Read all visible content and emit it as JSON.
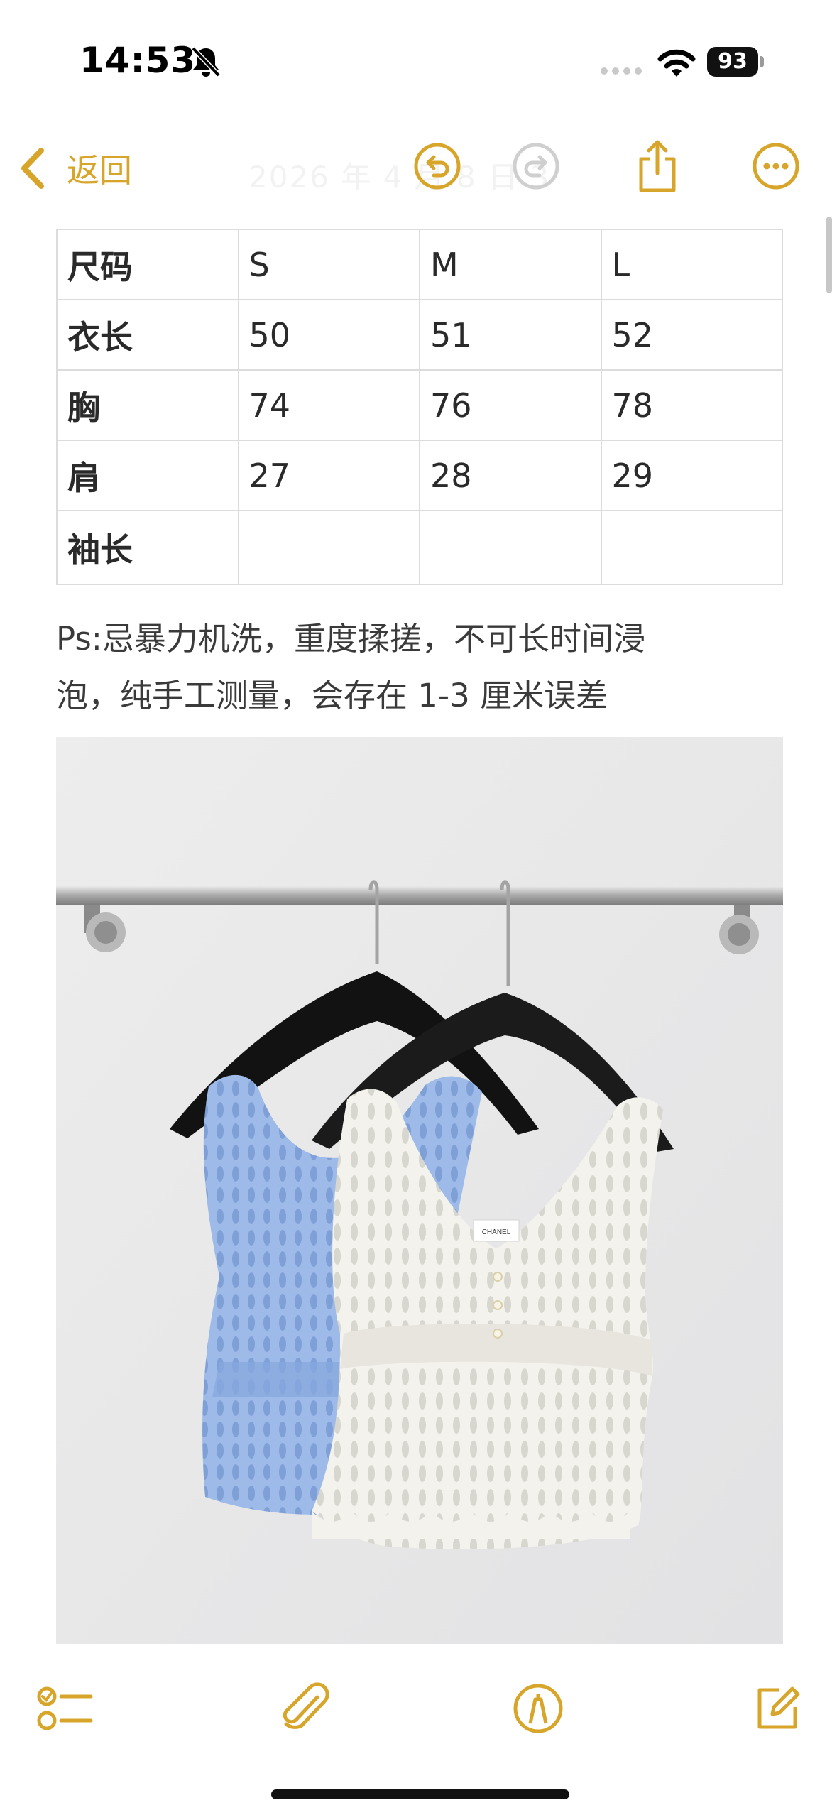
{
  "status_bar": {
    "time": "14:53",
    "battery": "93",
    "icons": [
      "bell-slash-icon",
      "signal-icon",
      "wifi-icon",
      "battery-icon"
    ]
  },
  "nav": {
    "back_label": "返回",
    "faded_date": "2026 年 4 月 8 日 3",
    "icons": [
      "chevron-left-icon",
      "undo-icon",
      "redo-icon",
      "share-icon",
      "more-icon"
    ]
  },
  "size_table": {
    "headers": [
      "尺码",
      "S",
      "M",
      "L"
    ],
    "rows": [
      [
        "衣长",
        "50",
        "51",
        "52"
      ],
      [
        "胸",
        "74",
        "76",
        "78"
      ],
      [
        "肩",
        "27",
        "28",
        "29"
      ],
      [
        "袖长",
        "",
        "",
        ""
      ]
    ]
  },
  "note": {
    "line1": "Ps:忌暴力机洗，重度揉搓，不可长时间浸",
    "line2": "泡，纯手工测量，会存在 1-3 厘米误差"
  },
  "photo": {
    "label_text": "CHANEL"
  },
  "toolbar": {
    "icons": [
      "checklist-icon",
      "paperclip-icon",
      "markup-pen-icon",
      "compose-icon"
    ]
  },
  "colors": {
    "accent": "#d8a52b",
    "top_blue": "#9fbbe8",
    "top_white": "#f4f3ee"
  }
}
